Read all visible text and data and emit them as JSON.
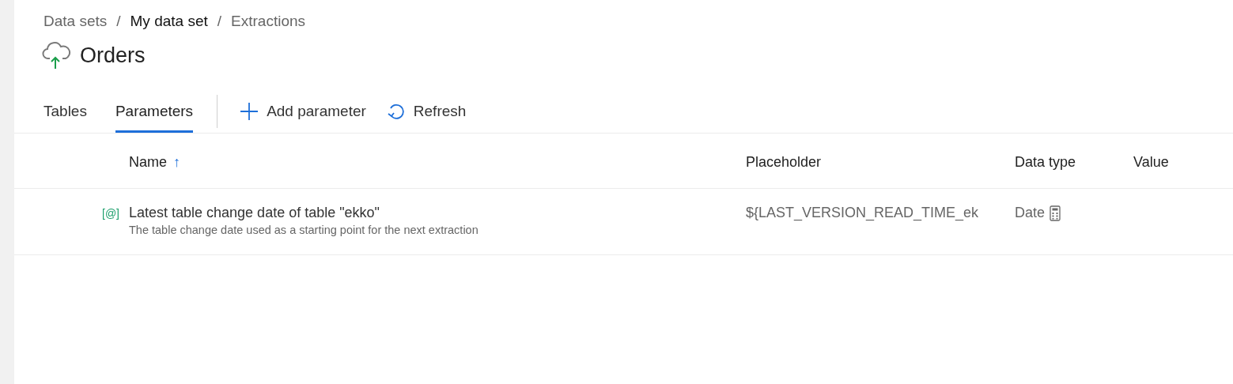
{
  "breadcrumb": [
    {
      "label": "Data sets",
      "highlighted": false
    },
    {
      "label": "My data set",
      "highlighted": true
    },
    {
      "label": "Extractions",
      "highlighted": false
    }
  ],
  "breadcrumb_separator": "/",
  "title": "Orders",
  "tabs": [
    {
      "label": "Tables",
      "selected": false
    },
    {
      "label": "Parameters",
      "selected": true
    }
  ],
  "actions": [
    {
      "label": "Add parameter",
      "kind": "add"
    },
    {
      "label": "Refresh",
      "kind": "refresh"
    }
  ],
  "table": {
    "columns": [
      {
        "label": "Name",
        "sort": "↑"
      },
      {
        "label": "Placeholder"
      },
      {
        "label": "Data type"
      },
      {
        "label": "Value"
      }
    ],
    "rows": [
      {
        "badge": "[@]",
        "name": "Latest table change date of table \"ekko\"",
        "description": "The table change date used as a starting point for the next extraction",
        "placeholder": "${LAST_VERSION_READ_TIME_ek",
        "data_type": "Date"
      }
    ]
  }
}
